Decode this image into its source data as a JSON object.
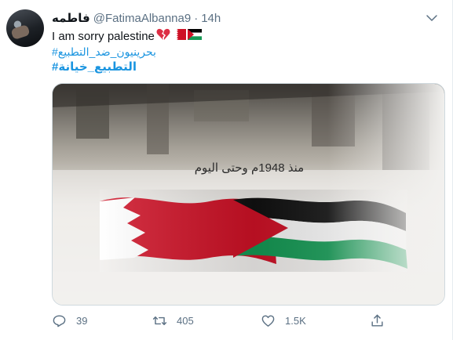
{
  "tweet": {
    "display_name": "فاطمه",
    "handle": "@FatimaAlbanna9",
    "separator": "·",
    "time": "14h",
    "text": "I am sorry palestine",
    "emojis": [
      "broken-heart",
      "bahrain-flag",
      "palestine-flag"
    ],
    "hashtag1": "#بحرينيون_ضد_التطبيع",
    "hashtag2": "#التطبيع_خيانة"
  },
  "media": {
    "caption": "منذ 1948م وحتى اليوم"
  },
  "actions": {
    "reply_count": "39",
    "retweet_count": "405",
    "like_count": "1.5K"
  },
  "colors": {
    "link": "#1b95e0",
    "muted": "#5b7083",
    "bahrain_red": "#ce1126",
    "palestine_green": "#149954"
  }
}
